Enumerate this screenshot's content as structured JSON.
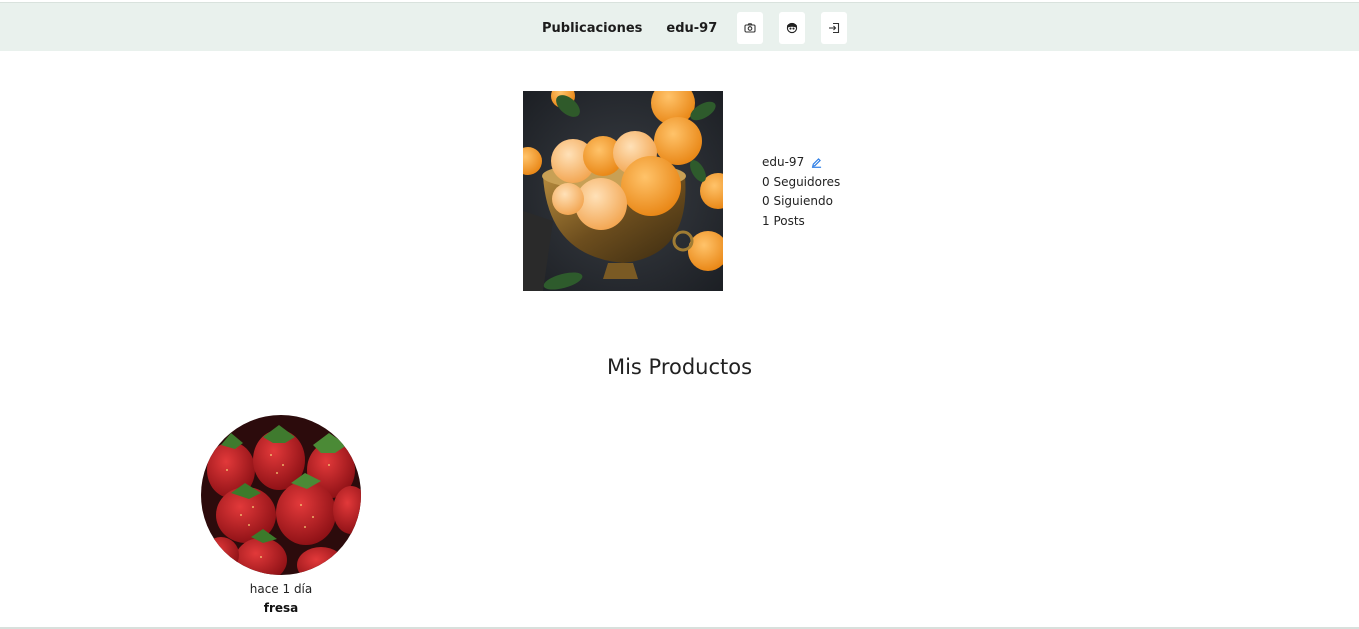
{
  "header": {
    "publications_label": "Publicaciones",
    "username_label": "edu-97",
    "icons": [
      "camera-icon",
      "profile-face-icon",
      "logout-icon"
    ]
  },
  "profile": {
    "avatar_alt": "Mandarinas peladas en un cuenco dorado",
    "username": "edu-97",
    "followers": "0 Seguidores",
    "following": "0 Siguiendo",
    "posts": "1 Posts"
  },
  "products_section": {
    "title": "Mis Productos",
    "items": [
      {
        "time": "hace 1 día",
        "name": "fresa",
        "image_alt": "Fresas"
      }
    ]
  },
  "colors": {
    "header_bg": "#e9f1ed",
    "edit_icon": "#2f7fe6",
    "text": "#222222"
  }
}
